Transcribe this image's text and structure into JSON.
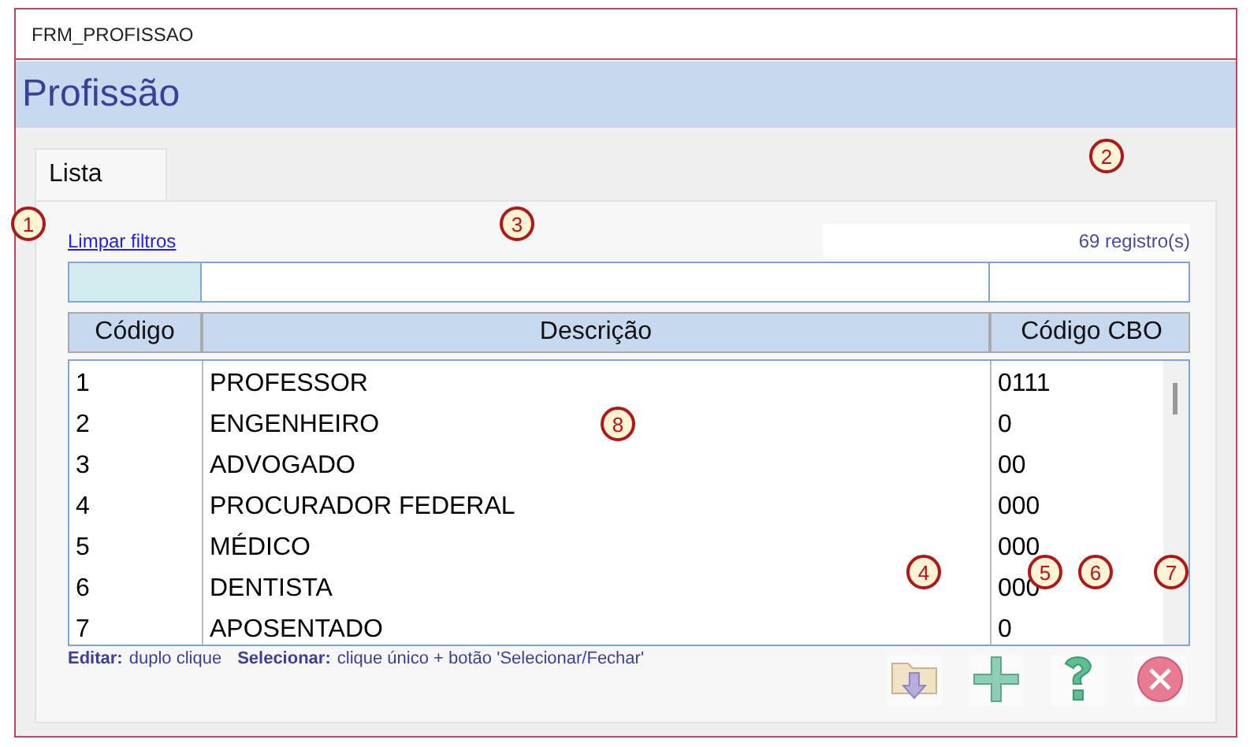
{
  "window": {
    "title": "FRM_PROFISSAO"
  },
  "header": {
    "title": "Profissão"
  },
  "tabs": [
    {
      "label": "Lista",
      "selected": true
    }
  ],
  "clear_filters_link": "Limpar filtros",
  "record_count": "69 registro(s)",
  "table": {
    "columns": [
      "Código",
      "Descrição",
      "Código CBO"
    ],
    "rows": [
      {
        "cells": [
          "1",
          "PROFESSOR",
          "0111"
        ]
      },
      {
        "cells": [
          "2",
          "ENGENHEIRO",
          "0"
        ]
      },
      {
        "cells": [
          "3",
          "ADVOGADO",
          "00"
        ]
      },
      {
        "cells": [
          "4",
          "PROCURADOR FEDERAL",
          "000"
        ]
      },
      {
        "cells": [
          "5",
          "MÉDICO",
          "000"
        ]
      },
      {
        "cells": [
          "6",
          "DENTISTA",
          "000"
        ]
      },
      {
        "cells": [
          "7",
          "APOSENTADO",
          "0"
        ]
      }
    ]
  },
  "hint": [
    {
      "label": "Editar:",
      "text": "duplo clique"
    },
    {
      "label": "Selecionar:",
      "text": "clique único + botão 'Selecionar/Fechar'"
    }
  ],
  "buttons": [
    {
      "kind": "export"
    },
    {
      "kind": "add"
    },
    {
      "kind": "help"
    },
    {
      "kind": "close"
    }
  ],
  "callouts": [
    "1",
    "2",
    "3",
    "4",
    "5",
    "6",
    "7",
    "8"
  ]
}
